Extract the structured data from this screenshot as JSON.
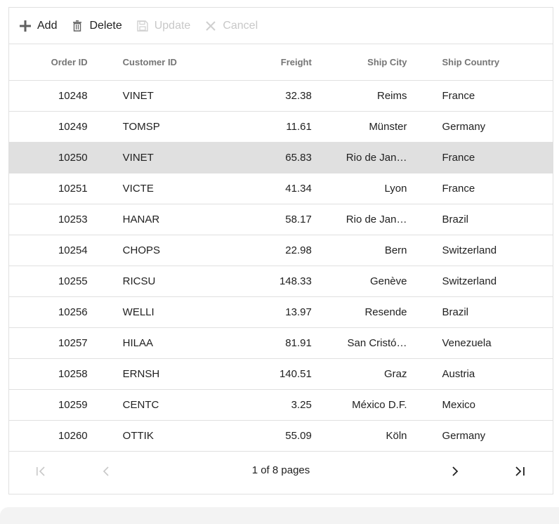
{
  "toolbar": {
    "add_label": "Add",
    "delete_label": "Delete",
    "update_label": "Update",
    "cancel_label": "Cancel"
  },
  "columns": {
    "order_id": "Order ID",
    "customer_id": "Customer ID",
    "freight": "Freight",
    "ship_city": "Ship City",
    "ship_country": "Ship Country"
  },
  "rows": [
    {
      "order_id": "10248",
      "customer_id": "VINET",
      "freight": "32.38",
      "ship_city": "Reims",
      "ship_country": "France"
    },
    {
      "order_id": "10249",
      "customer_id": "TOMSP",
      "freight": "11.61",
      "ship_city": "Münster",
      "ship_country": "Germany"
    },
    {
      "order_id": "10250",
      "customer_id": "VINET",
      "freight": "65.83",
      "ship_city": "Rio de Jan…",
      "ship_country": "France"
    },
    {
      "order_id": "10251",
      "customer_id": "VICTE",
      "freight": "41.34",
      "ship_city": "Lyon",
      "ship_country": "France"
    },
    {
      "order_id": "10253",
      "customer_id": "HANAR",
      "freight": "58.17",
      "ship_city": "Rio de Jan…",
      "ship_country": "Brazil"
    },
    {
      "order_id": "10254",
      "customer_id": "CHOPS",
      "freight": "22.98",
      "ship_city": "Bern",
      "ship_country": "Switzerland"
    },
    {
      "order_id": "10255",
      "customer_id": "RICSU",
      "freight": "148.33",
      "ship_city": "Genève",
      "ship_country": "Switzerland"
    },
    {
      "order_id": "10256",
      "customer_id": "WELLI",
      "freight": "13.97",
      "ship_city": "Resende",
      "ship_country": "Brazil"
    },
    {
      "order_id": "10257",
      "customer_id": "HILAA",
      "freight": "81.91",
      "ship_city": "San Cristó…",
      "ship_country": "Venezuela"
    },
    {
      "order_id": "10258",
      "customer_id": "ERNSH",
      "freight": "140.51",
      "ship_city": "Graz",
      "ship_country": "Austria"
    },
    {
      "order_id": "10259",
      "customer_id": "CENTC",
      "freight": "3.25",
      "ship_city": "México D.F.",
      "ship_country": "Mexico"
    },
    {
      "order_id": "10260",
      "customer_id": "OTTIK",
      "freight": "55.09",
      "ship_city": "Köln",
      "ship_country": "Germany"
    }
  ],
  "pager": {
    "info": "1 of 8 pages"
  },
  "colors": {
    "selected_row": "#e0e0e0",
    "border": "#e0e0e0",
    "header_text": "#757575",
    "disabled_text": "#c8c8c8"
  },
  "icons": {
    "add": "plus-icon",
    "delete": "trash-icon",
    "update": "save-icon",
    "cancel": "close-icon",
    "first": "first-page-icon",
    "prev": "chevron-left-icon",
    "next": "chevron-right-icon",
    "last": "last-page-icon"
  }
}
